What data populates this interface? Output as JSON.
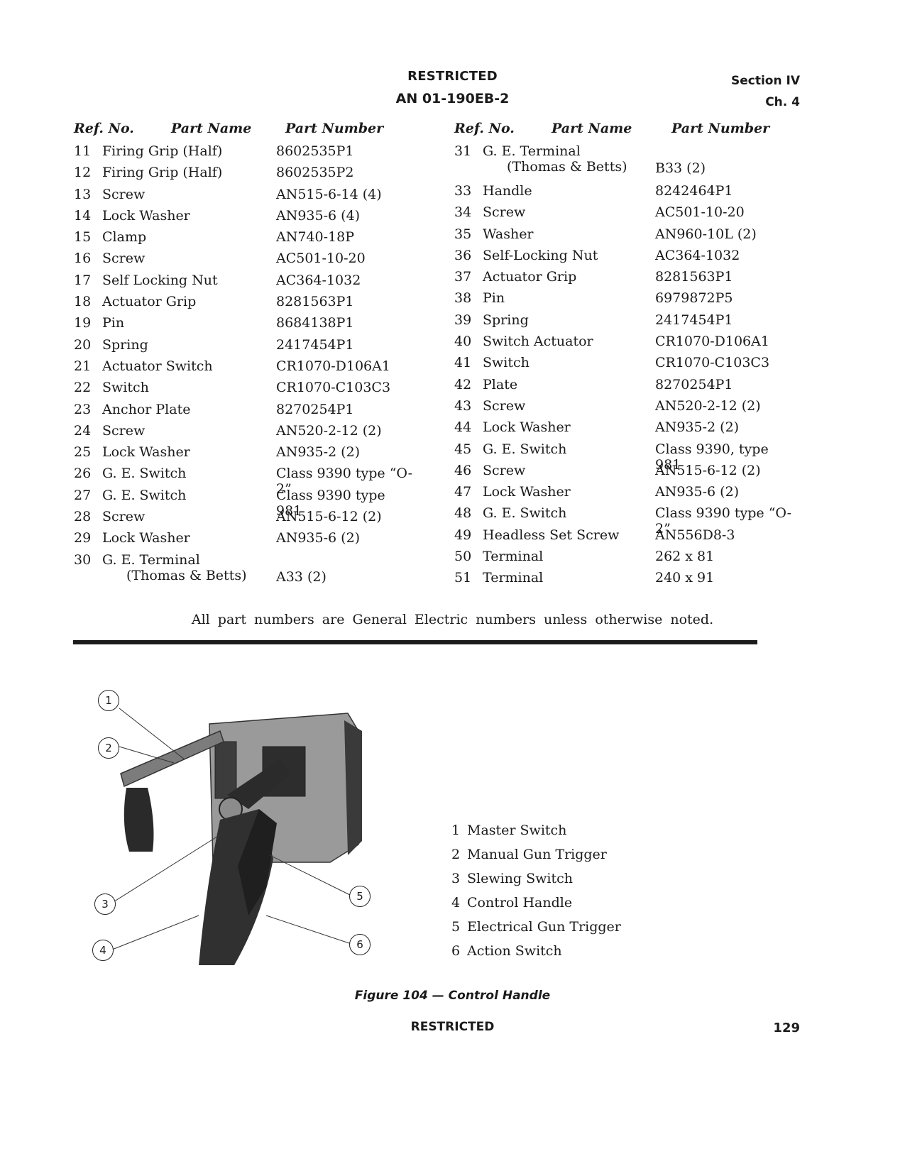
{
  "header": {
    "classification": "RESTRICTED",
    "document_number": "AN 01-190EB-2",
    "section": "Section IV",
    "chapter": "Ch. 4"
  },
  "table": {
    "headers": {
      "ref_no": "Ref. No.",
      "part_name": "Part Name",
      "part_number": "Part Number"
    },
    "left": [
      {
        "ref": "11",
        "name": "Firing Grip (Half)",
        "number": "8602535P1"
      },
      {
        "ref": "12",
        "name": "Firing Grip (Half)",
        "number": "8602535P2"
      },
      {
        "ref": "13",
        "name": "Screw",
        "number": "AN515-6-14 (4)"
      },
      {
        "ref": "14",
        "name": "Lock Washer",
        "number": "AN935-6 (4)"
      },
      {
        "ref": "15",
        "name": "Clamp",
        "number": "AN740-18P"
      },
      {
        "ref": "16",
        "name": "Screw",
        "number": "AC501-10-20"
      },
      {
        "ref": "17",
        "name": "Self Locking Nut",
        "number": "AC364-1032"
      },
      {
        "ref": "18",
        "name": "Actuator Grip",
        "number": "8281563P1"
      },
      {
        "ref": "19",
        "name": "Pin",
        "number": "8684138P1"
      },
      {
        "ref": "20",
        "name": "Spring",
        "number": "2417454P1"
      },
      {
        "ref": "21",
        "name": "Actuator Switch",
        "number": "CR1070-D106A1"
      },
      {
        "ref": "22",
        "name": "Switch",
        "number": "CR1070-C103C3"
      },
      {
        "ref": "23",
        "name": "Anchor Plate",
        "number": "8270254P1"
      },
      {
        "ref": "24",
        "name": "Screw",
        "number": "AN520-2-12 (2)"
      },
      {
        "ref": "25",
        "name": "Lock Washer",
        "number": "AN935-2 (2)"
      },
      {
        "ref": "26",
        "name": "G. E. Switch",
        "number": "Class 9390 type “O-2”"
      },
      {
        "ref": "27",
        "name": "G. E. Switch",
        "number": "Class 9390 type 981"
      },
      {
        "ref": "28",
        "name": "Screw",
        "number": "AN515-6-12 (2)"
      },
      {
        "ref": "29",
        "name": "Lock Washer",
        "number": "AN935-6 (2)"
      },
      {
        "ref": "30",
        "name": "G. E. Terminal",
        "name_line2": "(Thomas & Betts)",
        "number": "A33 (2)"
      }
    ],
    "right": [
      {
        "ref": "31",
        "name": "G. E. Terminal",
        "name_line2": "(Thomas & Betts)",
        "number": "B33 (2)"
      },
      {
        "ref": "33",
        "name": "Handle",
        "number": "8242464P1"
      },
      {
        "ref": "34",
        "name": "Screw",
        "number": "AC501-10-20"
      },
      {
        "ref": "35",
        "name": "Washer",
        "number": "AN960-10L (2)"
      },
      {
        "ref": "36",
        "name": "Self-Locking Nut",
        "number": "AC364-1032"
      },
      {
        "ref": "37",
        "name": "Actuator Grip",
        "number": "8281563P1"
      },
      {
        "ref": "38",
        "name": "Pin",
        "number": "6979872P5"
      },
      {
        "ref": "39",
        "name": "Spring",
        "number": "2417454P1"
      },
      {
        "ref": "40",
        "name": "Switch Actuator",
        "number": "CR1070-D106A1"
      },
      {
        "ref": "41",
        "name": "Switch",
        "number": "CR1070-C103C3"
      },
      {
        "ref": "42",
        "name": "Plate",
        "number": "8270254P1"
      },
      {
        "ref": "43",
        "name": "Screw",
        "number": "AN520-2-12 (2)"
      },
      {
        "ref": "44",
        "name": "Lock Washer",
        "number": "AN935-2 (2)"
      },
      {
        "ref": "45",
        "name": "G. E. Switch",
        "number": "Class 9390, type 981"
      },
      {
        "ref": "46",
        "name": "Screw",
        "number": "AN515-6-12 (2)"
      },
      {
        "ref": "47",
        "name": "Lock Washer",
        "number": "AN935-6 (2)"
      },
      {
        "ref": "48",
        "name": "G. E. Switch",
        "number": "Class 9390 type “O-2”"
      },
      {
        "ref": "49",
        "name": "Headless Set Screw",
        "number": "AN556D8-3"
      },
      {
        "ref": "50",
        "name": "Terminal",
        "number": "262 x 81"
      },
      {
        "ref": "51",
        "name": "Terminal",
        "number": "240 x 91"
      }
    ],
    "note": "All part numbers are General Electric numbers unless otherwise noted."
  },
  "figure": {
    "callouts": [
      "1",
      "2",
      "3",
      "4",
      "5",
      "6"
    ],
    "legend": [
      {
        "num": "1",
        "label": "Master Switch"
      },
      {
        "num": "2",
        "label": "Manual Gun Trigger"
      },
      {
        "num": "3",
        "label": "Slewing Switch"
      },
      {
        "num": "4",
        "label": "Control Handle"
      },
      {
        "num": "5",
        "label": "Electrical Gun Trigger"
      },
      {
        "num": "6",
        "label": "Action Switch"
      }
    ],
    "caption": "Figure 104 — Control Handle"
  },
  "footer": {
    "classification": "RESTRICTED",
    "page_number": "129"
  }
}
